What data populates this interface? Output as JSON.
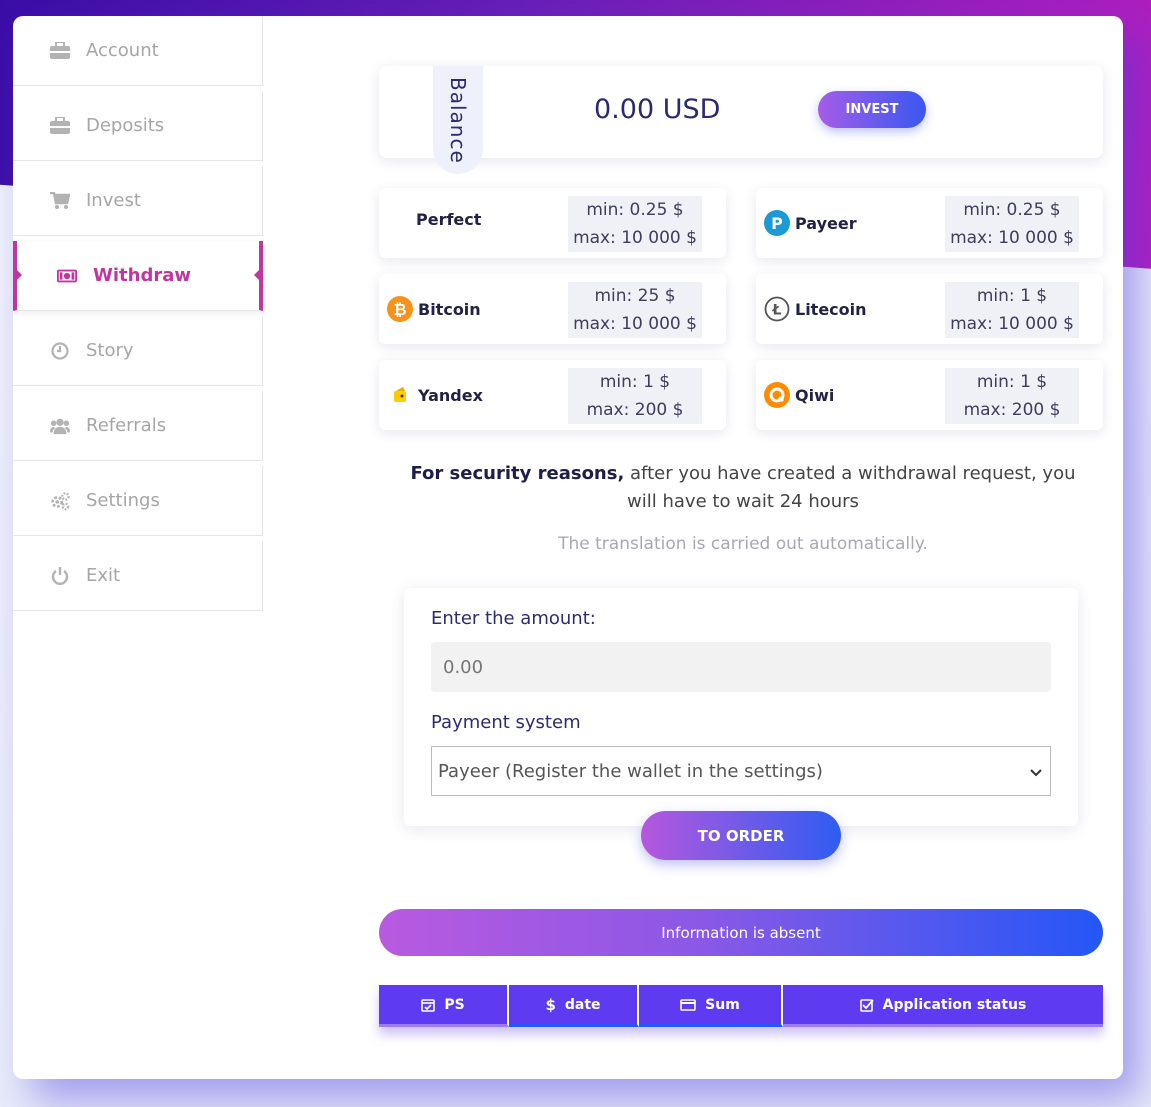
{
  "sidebar": {
    "items": [
      {
        "label": "Account",
        "icon": "briefcase-icon"
      },
      {
        "label": "Deposits",
        "icon": "briefcase-icon"
      },
      {
        "label": "Invest",
        "icon": "cart-icon"
      },
      {
        "label": "Withdraw",
        "icon": "money-icon",
        "active": true
      },
      {
        "label": "Story",
        "icon": "clock-icon"
      },
      {
        "label": "Referrals",
        "icon": "users-icon"
      },
      {
        "label": "Settings",
        "icon": "gears-icon"
      },
      {
        "label": "Exit",
        "icon": "power-icon"
      }
    ]
  },
  "balance": {
    "tab_label": "Balance",
    "amount": "0.00 USD",
    "invest_label": "INVEST"
  },
  "payment_systems": [
    {
      "name": "Perfect",
      "min": "min: 0.25 $",
      "max": "max: 10 000 $"
    },
    {
      "name": "Payeer",
      "min": "min: 0.25 $",
      "max": "max: 10 000 $"
    },
    {
      "name": "Bitcoin",
      "min": "min: 25 $",
      "max": "max: 10 000 $"
    },
    {
      "name": "Litecoin",
      "min": "min: 1 $",
      "max": "max: 10 000 $"
    },
    {
      "name": "Yandex",
      "min": "min: 1 $",
      "max": "max: 200 $"
    },
    {
      "name": "Qiwi",
      "min": "min: 1 $",
      "max": "max: 200 $"
    }
  ],
  "notice": {
    "bold": "For security reasons,",
    "text": " after you have created a withdrawal request, you will have to wait 24 hours",
    "auto": "The translation is carried out automatically."
  },
  "form": {
    "amount_label": "Enter the amount:",
    "amount_placeholder": "0.00",
    "ps_label": "Payment system",
    "ps_selected": "Payeer (Register the wallet in the settings)",
    "order_label": "TO ORDER"
  },
  "info_bar": "Information is absent",
  "table": {
    "headers": [
      "PS",
      "date",
      "Sum",
      "Application status"
    ]
  },
  "colors": {
    "accent": "#c0369f",
    "table_header": "#5e3bf0",
    "gradient_start": "#b558dd",
    "gradient_end": "#2f5cf2"
  }
}
